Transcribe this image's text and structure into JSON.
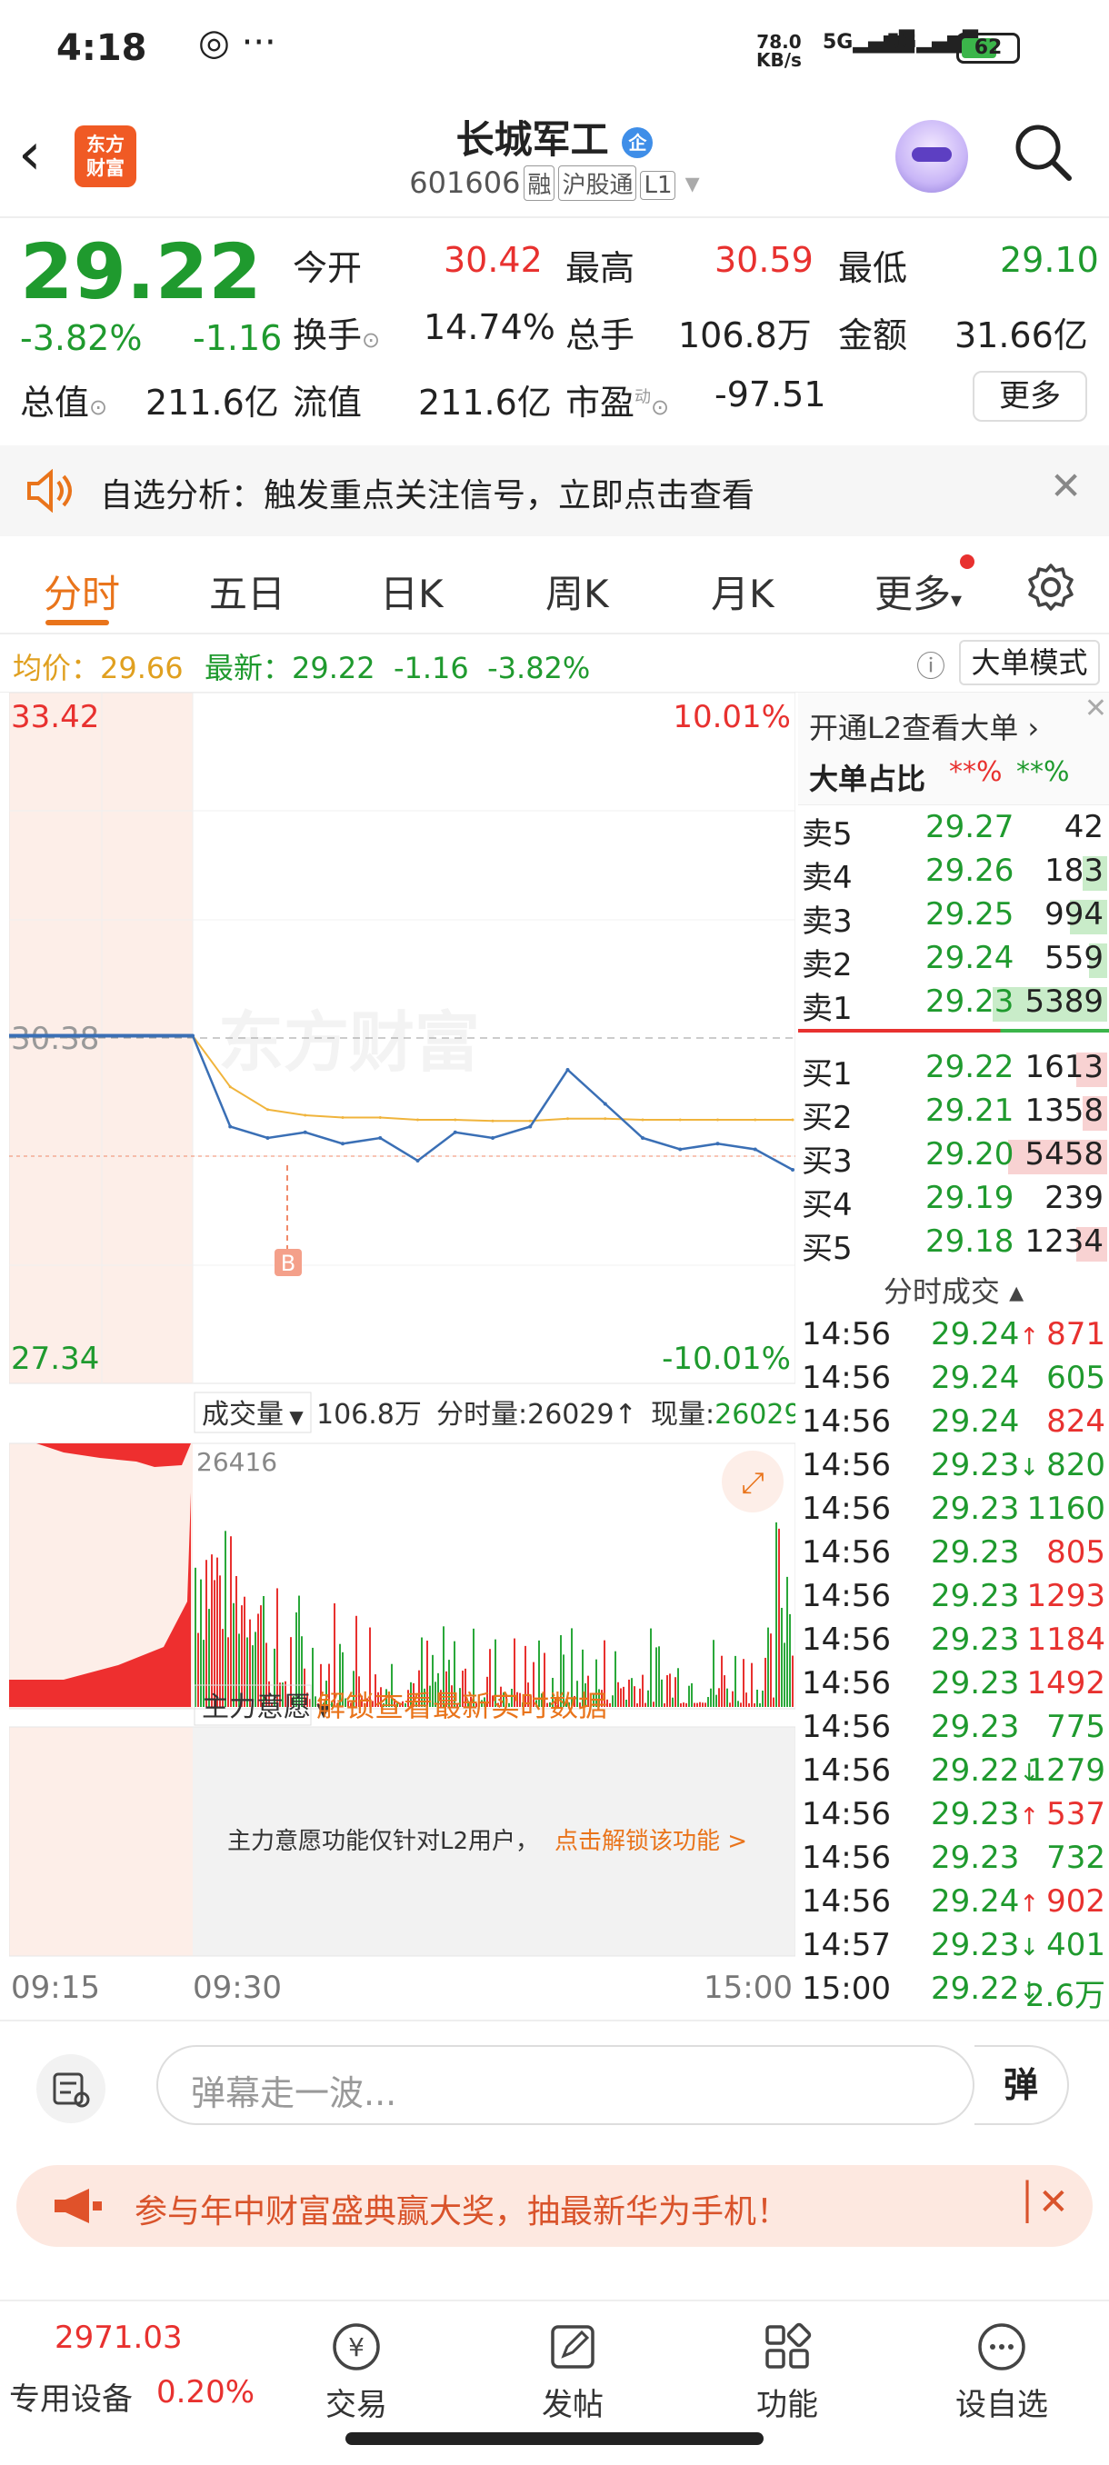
{
  "status": {
    "time": "4:18",
    "net_speed": "78.0",
    "net_unit": "KB/s",
    "sig1": "5G",
    "sig2": "5G",
    "battery": "62"
  },
  "header": {
    "logo_line1": "东方",
    "logo_line2": "财富",
    "title": "长城军工",
    "qi_badge": "企",
    "code": "601606",
    "tags": [
      "融",
      "沪股通",
      "L1"
    ]
  },
  "quote": {
    "price": "29.22",
    "change_pct": "-3.82%",
    "change": "-1.16",
    "open_label": "今开",
    "open": "30.42",
    "high_label": "最高",
    "high": "30.59",
    "low_label": "最低",
    "low": "29.10",
    "turnover_label": "换手",
    "turnover": "14.74%",
    "vol_label": "总手",
    "vol": "106.8万",
    "amount_label": "金额",
    "amount": "31.66亿",
    "mktcap_label": "总值",
    "mktcap": "211.6亿",
    "float_label": "流值",
    "float": "211.6亿",
    "pe_label": "市盈",
    "pe_sup": "动",
    "pe": "-97.51",
    "more": "更多"
  },
  "notice": {
    "text": "自选分析：触发重点关注信号，立即点击查看"
  },
  "tabs": [
    "分时",
    "五日",
    "日K",
    "周K",
    "月K",
    "更多"
  ],
  "avgbar": {
    "avg_label": "均价：",
    "avg": "29.66",
    "latest_label": "最新：",
    "latest": "29.22",
    "chg": "-1.16",
    "pct": "-3.82%",
    "mode": "大单模式"
  },
  "chart": {
    "y_top": "33.42",
    "y_mid": "30.38",
    "y_bot": "27.34",
    "pct_top": "10.01%",
    "pct_bot": "-10.01%",
    "marker": "B",
    "watermark": "东方财富",
    "vol_label": "成交量",
    "vol_total": "106.8万",
    "fs_label": "分时量:26029",
    "fs_arrow": "↑",
    "now_label": "现量:",
    "now_val": "26029",
    "vol_max": "26416",
    "main_label": "主力意愿",
    "unlock": "解锁查看最新实时数据",
    "l2_note": "主力意愿功能仅针对L2用户，",
    "l2_link": "点击解锁该功能 >",
    "t_start": "09:15",
    "t_open": "09:30",
    "t_end": "15:00"
  },
  "chart_data": {
    "type": "line",
    "title": "",
    "prev_close": 30.38,
    "ylim": [
      27.34,
      33.42
    ],
    "x": [
      "09:30",
      "09:45",
      "10:00",
      "10:15",
      "10:30",
      "10:45",
      "11:00",
      "11:15",
      "11:30",
      "13:15",
      "13:30",
      "13:45",
      "14:00",
      "14:15",
      "14:30",
      "14:45",
      "15:00"
    ],
    "series": [
      {
        "values": [
          30.4,
          29.6,
          29.5,
          29.55,
          29.45,
          29.5,
          29.3,
          29.55,
          29.5,
          29.6,
          30.1,
          29.8,
          29.5,
          29.4,
          29.45,
          29.4,
          29.22
        ]
      },
      {
        "values": [
          30.4,
          29.95,
          29.75,
          29.7,
          29.68,
          29.68,
          29.66,
          29.66,
          29.65,
          29.65,
          29.67,
          29.67,
          29.66,
          29.66,
          29.66,
          29.66,
          29.66
        ]
      }
    ]
  },
  "book": {
    "l2": "开通L2查看大单 ›",
    "ratio_label": "大单占比",
    "ratio_red": "**%",
    "ratio_green": "**%",
    "asks": [
      {
        "l": "卖5",
        "p": "29.27",
        "v": "42"
      },
      {
        "l": "卖4",
        "p": "29.26",
        "v": "183"
      },
      {
        "l": "卖3",
        "p": "29.25",
        "v": "994"
      },
      {
        "l": "卖2",
        "p": "29.24",
        "v": "559"
      },
      {
        "l": "卖1",
        "p": "29.23",
        "v": "5389"
      }
    ],
    "bids": [
      {
        "l": "买1",
        "p": "29.22",
        "v": "1613"
      },
      {
        "l": "买2",
        "p": "29.21",
        "v": "1358"
      },
      {
        "l": "买3",
        "p": "29.20",
        "v": "5458"
      },
      {
        "l": "买4",
        "p": "29.19",
        "v": "239"
      },
      {
        "l": "买5",
        "p": "29.18",
        "v": "1234"
      }
    ],
    "trades_label": "分时成交",
    "trades": [
      {
        "t": "14:56",
        "p": "29.24↑",
        "v": "871",
        "pc": "green",
        "vc": "red"
      },
      {
        "t": "14:56",
        "p": "29.24",
        "v": "605",
        "pc": "green",
        "vc": "green"
      },
      {
        "t": "14:56",
        "p": "29.24",
        "v": "824",
        "pc": "green",
        "vc": "red"
      },
      {
        "t": "14:56",
        "p": "29.23↓",
        "v": "820",
        "pc": "green",
        "vc": "green"
      },
      {
        "t": "14:56",
        "p": "29.23",
        "v": "1160",
        "pc": "green",
        "vc": "green"
      },
      {
        "t": "14:56",
        "p": "29.23",
        "v": "805",
        "pc": "green",
        "vc": "red"
      },
      {
        "t": "14:56",
        "p": "29.23",
        "v": "1293",
        "pc": "green",
        "vc": "red"
      },
      {
        "t": "14:56",
        "p": "29.23",
        "v": "1184",
        "pc": "green",
        "vc": "red"
      },
      {
        "t": "14:56",
        "p": "29.23",
        "v": "1492",
        "pc": "green",
        "vc": "red"
      },
      {
        "t": "14:56",
        "p": "29.23",
        "v": "775",
        "pc": "green",
        "vc": "green"
      },
      {
        "t": "14:56",
        "p": "29.22↓",
        "v": "1279",
        "pc": "green",
        "vc": "green"
      },
      {
        "t": "14:56",
        "p": "29.23↑",
        "v": "537",
        "pc": "green",
        "vc": "red"
      },
      {
        "t": "14:56",
        "p": "29.23",
        "v": "732",
        "pc": "green",
        "vc": "green"
      },
      {
        "t": "14:56",
        "p": "29.24↑",
        "v": "902",
        "pc": "green",
        "vc": "red"
      },
      {
        "t": "14:57",
        "p": "29.23↓",
        "v": "401",
        "pc": "green",
        "vc": "green"
      },
      {
        "t": "15:00",
        "p": "29.22↓",
        "v": "2.6万",
        "pc": "green",
        "vc": "green"
      }
    ]
  },
  "danmu": {
    "placeholder": "弹幕走一波...",
    "btn": "弹"
  },
  "ad": {
    "text": "参与年中财富盛典赢大奖，抽最新华为手机！"
  },
  "bottom": {
    "index": "2971.03",
    "index_pct": "0.20%",
    "device": "专用设备",
    "nav": [
      "交易",
      "发帖",
      "功能",
      "设自选"
    ]
  }
}
